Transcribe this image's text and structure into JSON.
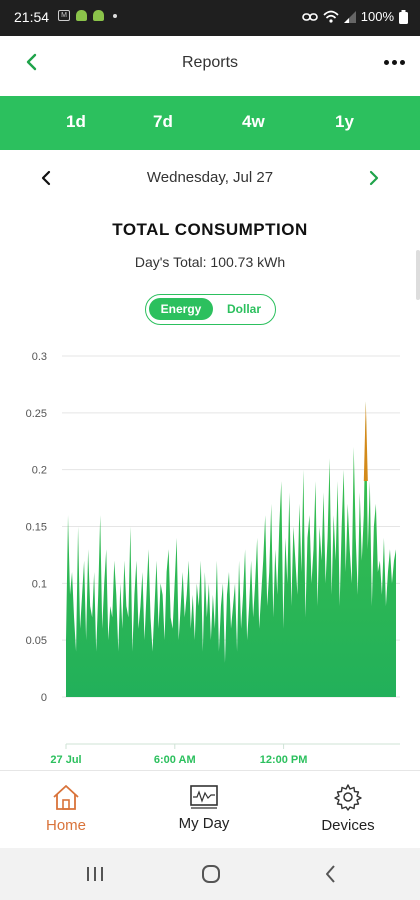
{
  "status": {
    "time": "21:54",
    "battery": "100%"
  },
  "header": {
    "title": "Reports"
  },
  "ranges": [
    {
      "label": "1d",
      "selected": true
    },
    {
      "label": "7d",
      "selected": false
    },
    {
      "label": "4w",
      "selected": false
    },
    {
      "label": "1y",
      "selected": false
    }
  ],
  "date": {
    "label": "Wednesday, Jul 27"
  },
  "summary": {
    "title": "TOTAL CONSUMPTION",
    "total": "Day's Total: 100.73 kWh"
  },
  "toggle": {
    "energy": "Energy",
    "dollar": "Dollar",
    "selected": "Energy"
  },
  "chart_data": {
    "type": "area",
    "ylim": [
      0,
      0.3
    ],
    "y_ticks": [
      "0",
      "0.05",
      "0.1",
      "0.15",
      "0.2",
      "0.25",
      "0.3"
    ],
    "x_tick_labels": [
      "27 Jul",
      "6:00 AM",
      "12:00 PM"
    ],
    "x_hours": [
      0,
      24
    ],
    "grid": true,
    "colors": {
      "base": "#1fb24e",
      "peak": "#d38a1a"
    },
    "values": [
      0.05,
      0.16,
      0.09,
      0.11,
      0.07,
      0.04,
      0.15,
      0.06,
      0.09,
      0.12,
      0.05,
      0.13,
      0.08,
      0.07,
      0.11,
      0.04,
      0.09,
      0.16,
      0.06,
      0.1,
      0.13,
      0.05,
      0.08,
      0.07,
      0.12,
      0.09,
      0.04,
      0.1,
      0.06,
      0.12,
      0.08,
      0.07,
      0.15,
      0.04,
      0.09,
      0.12,
      0.06,
      0.08,
      0.11,
      0.05,
      0.09,
      0.13,
      0.07,
      0.04,
      0.08,
      0.12,
      0.06,
      0.1,
      0.09,
      0.05,
      0.11,
      0.13,
      0.07,
      0.06,
      0.1,
      0.14,
      0.05,
      0.08,
      0.11,
      0.07,
      0.09,
      0.12,
      0.06,
      0.09,
      0.05,
      0.1,
      0.08,
      0.12,
      0.04,
      0.11,
      0.07,
      0.1,
      0.05,
      0.09,
      0.06,
      0.12,
      0.04,
      0.08,
      0.1,
      0.03,
      0.09,
      0.11,
      0.06,
      0.08,
      0.1,
      0.04,
      0.12,
      0.06,
      0.09,
      0.13,
      0.05,
      0.08,
      0.12,
      0.07,
      0.1,
      0.14,
      0.06,
      0.09,
      0.12,
      0.16,
      0.08,
      0.11,
      0.17,
      0.07,
      0.13,
      0.09,
      0.15,
      0.19,
      0.06,
      0.14,
      0.1,
      0.18,
      0.08,
      0.15,
      0.12,
      0.09,
      0.17,
      0.11,
      0.2,
      0.07,
      0.14,
      0.16,
      0.1,
      0.13,
      0.19,
      0.08,
      0.15,
      0.12,
      0.18,
      0.1,
      0.14,
      0.21,
      0.09,
      0.16,
      0.12,
      0.19,
      0.08,
      0.15,
      0.2,
      0.11,
      0.17,
      0.13,
      0.1,
      0.22,
      0.14,
      0.09,
      0.18,
      0.12,
      0.16,
      0.26,
      0.13,
      0.19,
      0.08,
      0.15,
      0.17,
      0.11,
      0.12,
      0.09,
      0.14,
      0.08,
      0.11,
      0.13,
      0.1,
      0.12,
      0.13
    ]
  },
  "bottom_nav": [
    {
      "label": "Home",
      "active": true
    },
    {
      "label": "My Day",
      "active": false
    },
    {
      "label": "Devices",
      "active": false
    }
  ]
}
